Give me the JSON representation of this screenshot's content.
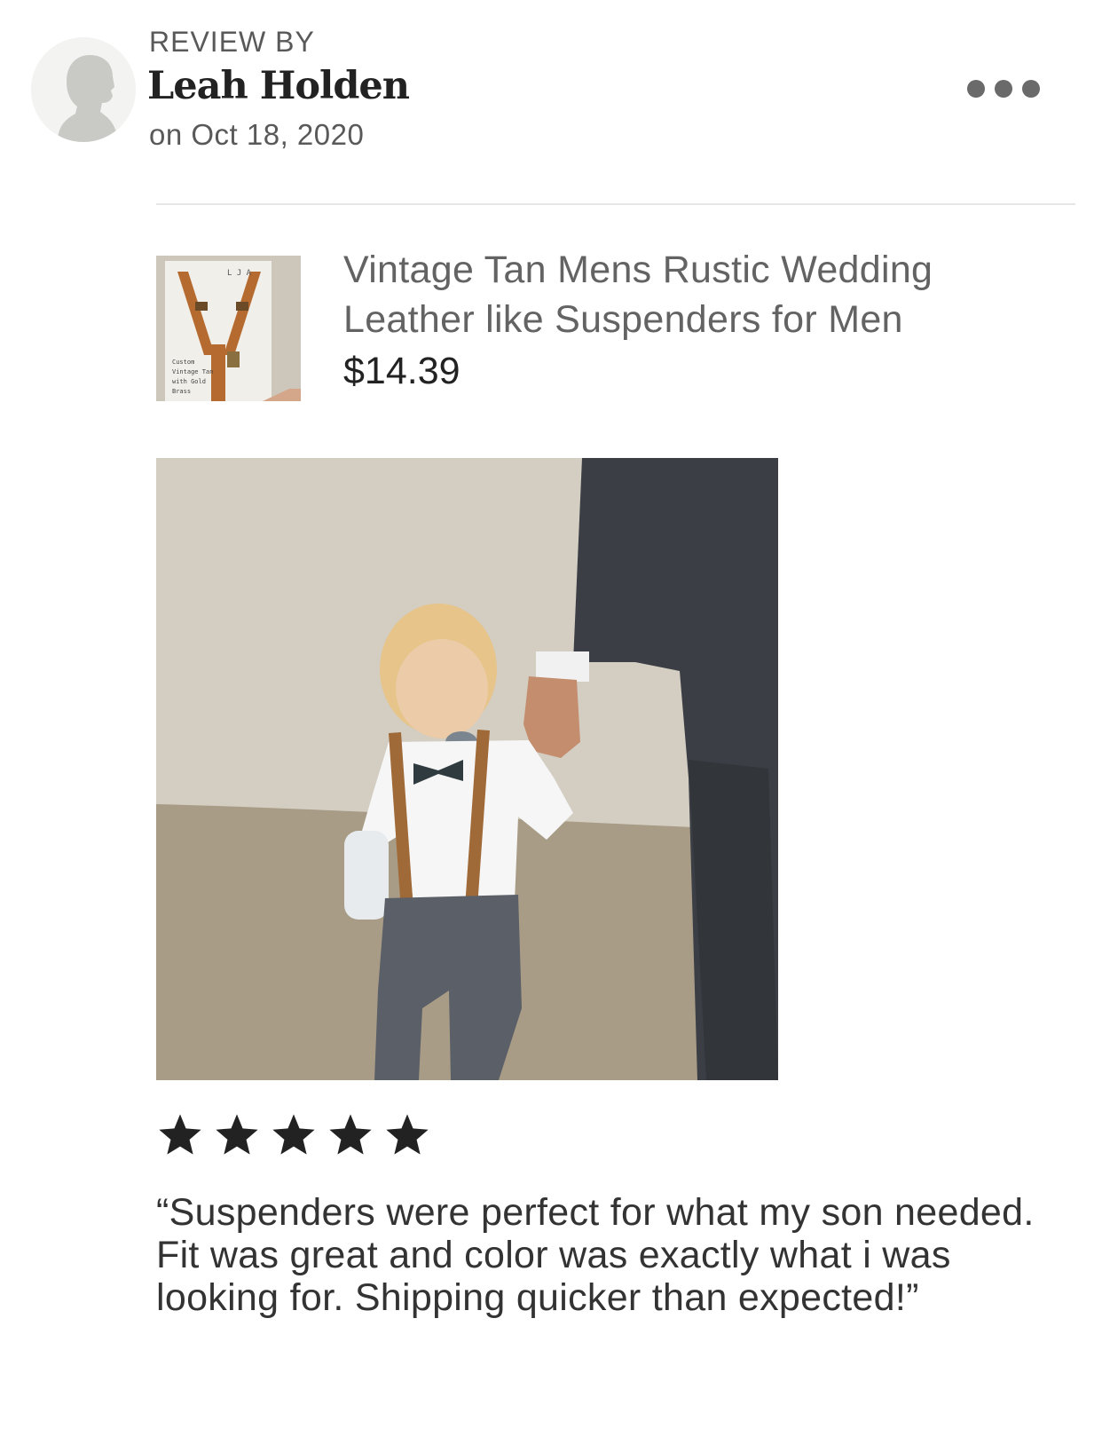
{
  "review": {
    "header_label": "REVIEW BY",
    "reviewer_name": "Leah Holden",
    "date": "on Oct 18, 2020",
    "rating": 5,
    "rating_max": 5,
    "text": "“Suspenders were perfect for what my son needed. Fit was great and color was exactly what i was looking for. Shipping quicker than expected!”"
  },
  "product": {
    "title": "Vintage Tan Mens Rustic Wedding Leather like Suspenders for Men",
    "price": "$14.39",
    "thumb_label": "L J A",
    "thumb_caption": [
      "Custom",
      "Vintage Tan",
      "with Gold",
      "Brass"
    ]
  },
  "icons": {
    "more": "more-dots-icon",
    "avatar": "default-avatar-icon",
    "star": "star-icon"
  },
  "colors": {
    "star": "#222222",
    "muted_text": "#595959",
    "more_dots": "#6a6a6a"
  }
}
